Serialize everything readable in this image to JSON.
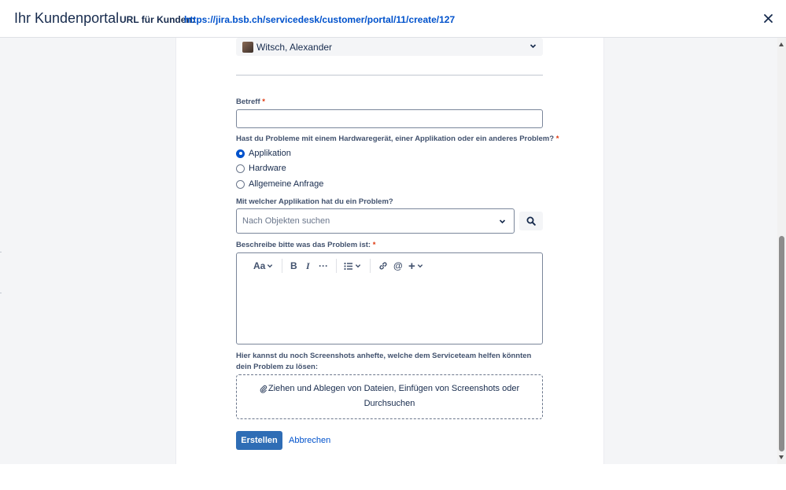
{
  "header": {
    "title": "Ihr Kundenportal",
    "url_label": "URL für Kunden:",
    "url": "https://jira.bsb.ch/servicedesk/customer/portal/11/create/127"
  },
  "form": {
    "user_select": {
      "value": "Witsch, Alexander"
    },
    "subject": {
      "label": "Betreff",
      "required_mark": "*",
      "value": ""
    },
    "problem_type": {
      "label": "Hast du Probleme mit einem Hardwaregerät, einer Applikation oder ein anderes Problem?",
      "required_mark": "*",
      "options": [
        {
          "label": "Applikation",
          "checked": true
        },
        {
          "label": "Hardware",
          "checked": false
        },
        {
          "label": "Allgemeine Anfrage",
          "checked": false
        }
      ]
    },
    "application": {
      "label": "Mit welcher Applikation hat du ein Problem?",
      "placeholder": "Nach Objekten suchen"
    },
    "description": {
      "label": "Beschreibe bitte was das Problem ist:",
      "required_mark": "*",
      "toolbar": {
        "text_style": "Aa",
        "bold": "B",
        "italic": "I",
        "more": "···",
        "list": "list",
        "link": "link",
        "mention": "@",
        "insert": "+"
      }
    },
    "attachments": {
      "label": "Hier kannst du noch Screenshots anhefte, welche dem Serviceteam helfen könnten dein Problem zu lösen:",
      "drop_text_line1": "Ziehen und Ablegen von Dateien, Einfügen von Screenshots oder",
      "drop_text_line2": "Durchsuchen"
    },
    "buttons": {
      "create": "Erstellen",
      "cancel": "Abbrechen"
    }
  },
  "colors": {
    "primary": "#2f6db5",
    "link": "#0052cc",
    "radio_checked": "#0052cc",
    "required": "#de350b"
  },
  "icons": [
    "close-icon",
    "chevron-down-icon",
    "search-icon",
    "paperclip-icon",
    "link-icon",
    "bullet-list-icon"
  ]
}
